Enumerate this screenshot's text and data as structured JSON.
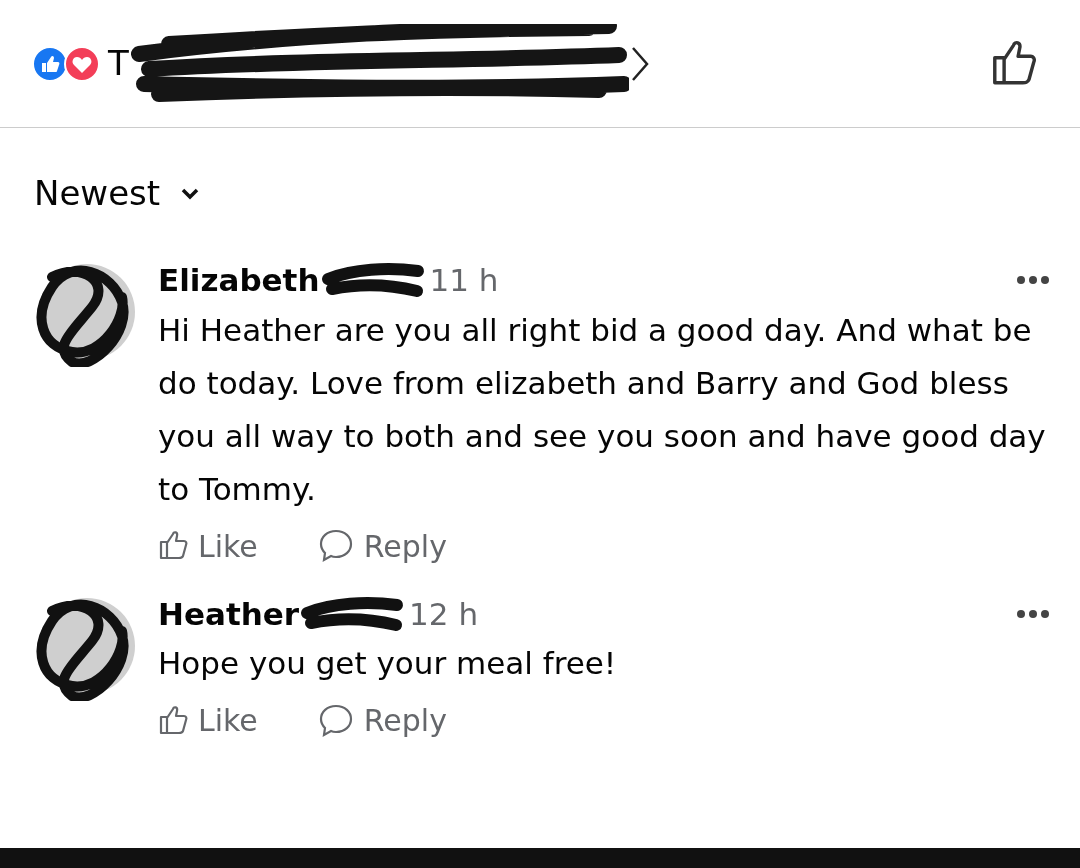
{
  "header": {
    "reactions": [
      {
        "kind": "like"
      },
      {
        "kind": "love"
      }
    ],
    "title": "T"
  },
  "sort": {
    "label": "Newest"
  },
  "comments": [
    {
      "author": "Elizabeth",
      "time": "11 h",
      "text": "Hi Heather are you all right bid a good day. And what be do today. Love from elizabeth and Barry and God bless you all way to both and see you soon and have good day to Tommy.",
      "actions": [
        "Like",
        "Reply"
      ]
    },
    {
      "author": "Heather",
      "time": "12 h",
      "text": "Hope you get your meal free!",
      "actions": [
        "Like",
        "Reply"
      ]
    }
  ]
}
